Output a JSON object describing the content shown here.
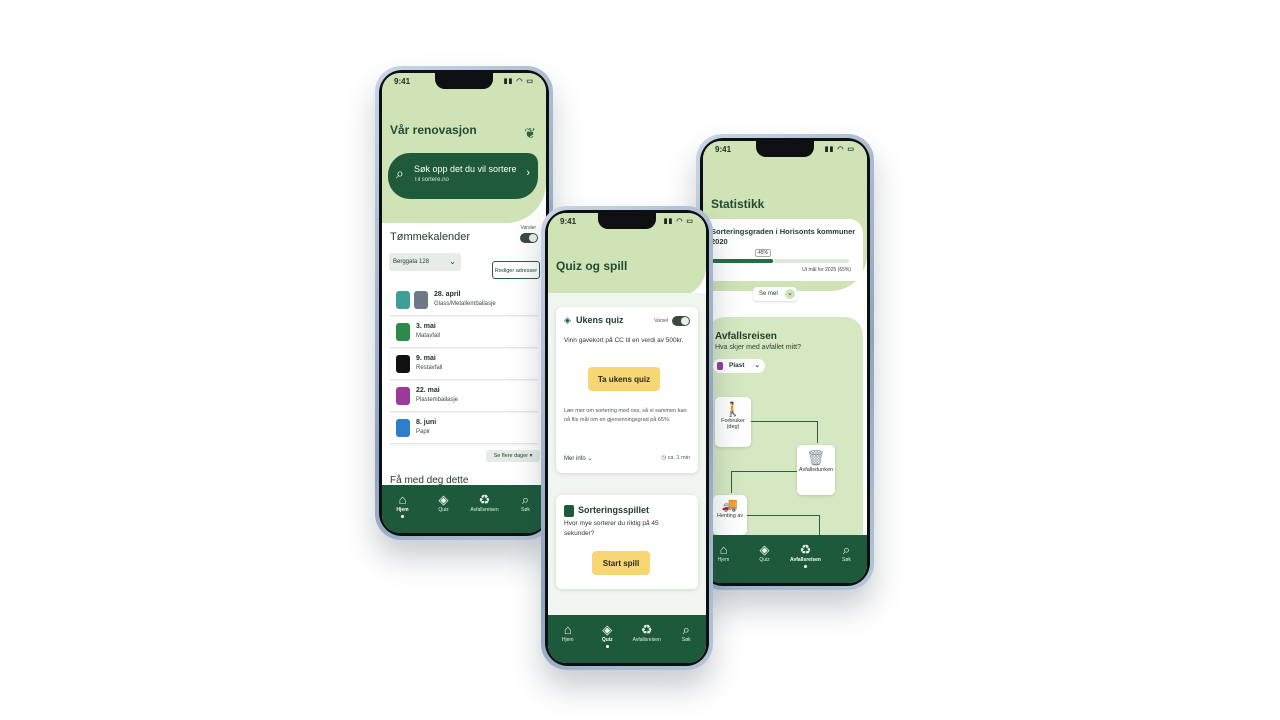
{
  "time": "9:41",
  "phone1": {
    "title": "Vår renovasjon",
    "search_title": "Søk opp det du vil sortere",
    "search_sub": "Til sortere.no",
    "calendar_title": "Tømmekalender",
    "toggle_label": "Varsler",
    "address": "Berggata 128",
    "edit_address": "Rediger adresser",
    "events": [
      {
        "date": "28. april",
        "type": "Glass/Metallemballasje",
        "color": "#3e9e98"
      },
      {
        "date": "3. mai",
        "type": "Matavfall",
        "color": "#2e8a4b"
      },
      {
        "date": "9. mai",
        "type": "Restavfall",
        "color": "#111111"
      },
      {
        "date": "22. mai",
        "type": "Plastemballasje",
        "color": "#9b3a99"
      },
      {
        "date": "8. juni",
        "type": "Papir",
        "color": "#2f7fc8"
      }
    ],
    "more_days": "Se flere dager",
    "bottom_title": "Få med deg dette",
    "tabs": [
      {
        "label": "Hjem",
        "icon": "home-icon",
        "glyph": "⌂",
        "active": true
      },
      {
        "label": "Quiz",
        "icon": "graduation-cap-icon",
        "glyph": "🎓",
        "active": false
      },
      {
        "label": "Avfallsreisen",
        "icon": "recycle-icon",
        "glyph": "♻",
        "active": false
      },
      {
        "label": "Søk",
        "icon": "search-icon",
        "glyph": "⌕",
        "active": false
      }
    ]
  },
  "phone2": {
    "title": "Quiz og spill",
    "quiz_title": "Ukens quiz",
    "toggle_label": "Varsel",
    "prize": "Vinn gavekort på CC til en verdi av 500kr.",
    "quiz_button": "Ta ukens quiz",
    "info_text": "Lær mer om sortering med oss, så vi sammen kan nå fils mål om en gjenvinningsgrad på 65%.",
    "more_info": "Mer info",
    "duration": "ca. 1 min",
    "game_title": "Sorteringsspillet",
    "game_desc": "Hvor mye sorterer du riktig på 45 sekunder?",
    "game_button": "Start spill",
    "tabs": [
      {
        "label": "Hjem",
        "icon": "home-icon",
        "glyph": "⌂",
        "active": false
      },
      {
        "label": "Quiz",
        "icon": "graduation-cap-icon",
        "glyph": "🎓",
        "active": true
      },
      {
        "label": "Avfallsreisen",
        "icon": "recycle-icon",
        "glyph": "♻",
        "active": false
      },
      {
        "label": "Søk",
        "icon": "search-icon",
        "glyph": "⌕",
        "active": false
      }
    ]
  },
  "phone3": {
    "title": "Statistikk",
    "stat_title": "Sorteringsgraden i Horisonts kommuner 2020",
    "progress_value": "45%",
    "progress_fraction": 0.45,
    "goal": "Ut mål for 2025 (65%)",
    "see_more": "Se mer",
    "journey_title": "Avfallsreisen",
    "journey_sub": "Hva skjer med avfallet mitt?",
    "material": "Plast",
    "flow": [
      "Forbruker (deg)",
      "Avfallsdunken",
      "Henting av"
    ],
    "tabs": [
      {
        "label": "Hjem",
        "icon": "home-icon",
        "glyph": "⌂",
        "active": false
      },
      {
        "label": "Quiz",
        "icon": "graduation-cap-icon",
        "glyph": "🎓",
        "active": false
      },
      {
        "label": "Avfallsreisen",
        "icon": "recycle-icon",
        "glyph": "♻",
        "active": true
      },
      {
        "label": "Søk",
        "icon": "search-icon",
        "glyph": "⌕",
        "active": false
      }
    ]
  }
}
